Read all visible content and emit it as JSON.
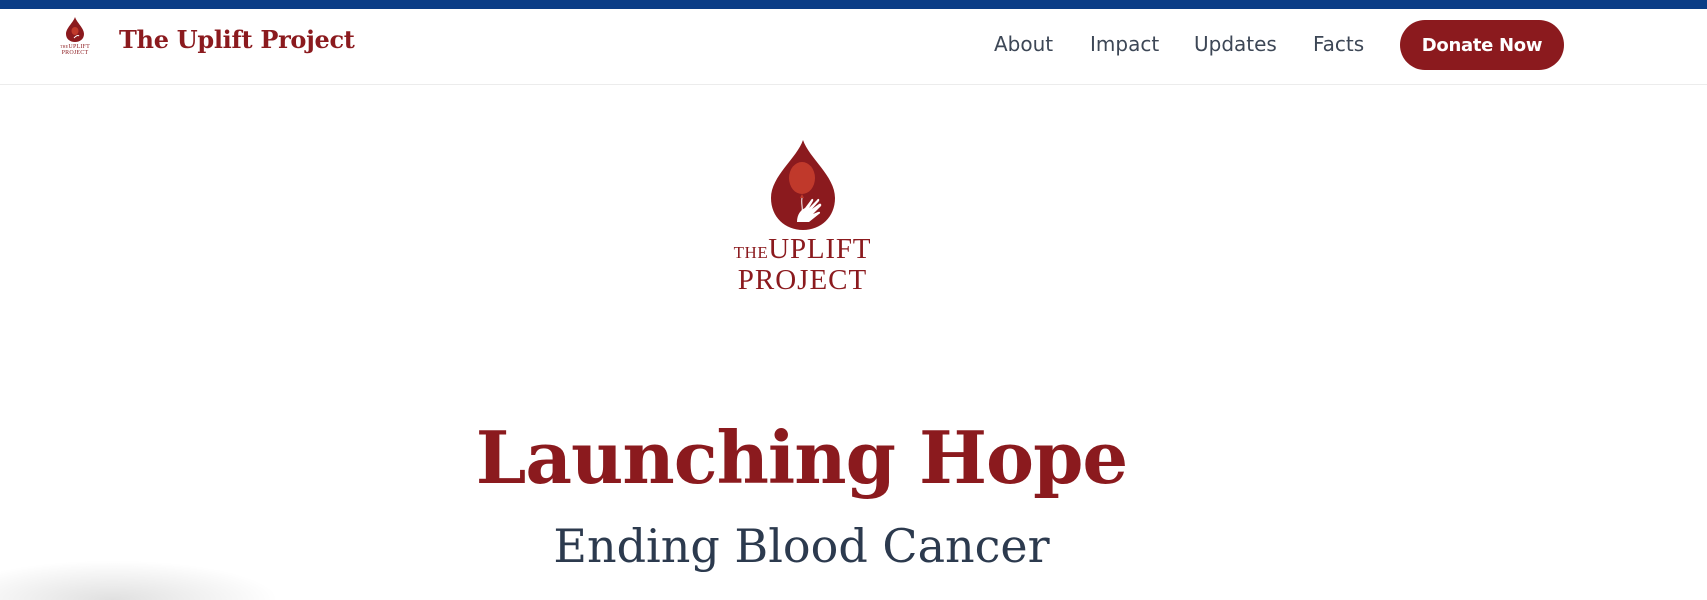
{
  "colors": {
    "brand": "#8b1a1e",
    "stripe": "#0b3d86",
    "nav_text": "#3d4756",
    "subtitle": "#2c3a4e"
  },
  "header": {
    "logo_icon": "blood-drop-balloon-icon",
    "logo_text_line1_small": "THE",
    "logo_text_line1": "UPLIFT",
    "logo_text_line2": "PROJECT",
    "brand_name": "The Uplift Project",
    "nav": [
      {
        "label": "About"
      },
      {
        "label": "Impact"
      },
      {
        "label": "Updates"
      },
      {
        "label": "Facts"
      }
    ],
    "donate_label": "Donate Now"
  },
  "hero": {
    "logo_icon": "blood-drop-balloon-hand-icon",
    "logo_the": "THE",
    "logo_uplift": "UPLIFT",
    "logo_project": "PROJECT",
    "title": "Launching Hope",
    "subtitle": "Ending Blood Cancer"
  }
}
